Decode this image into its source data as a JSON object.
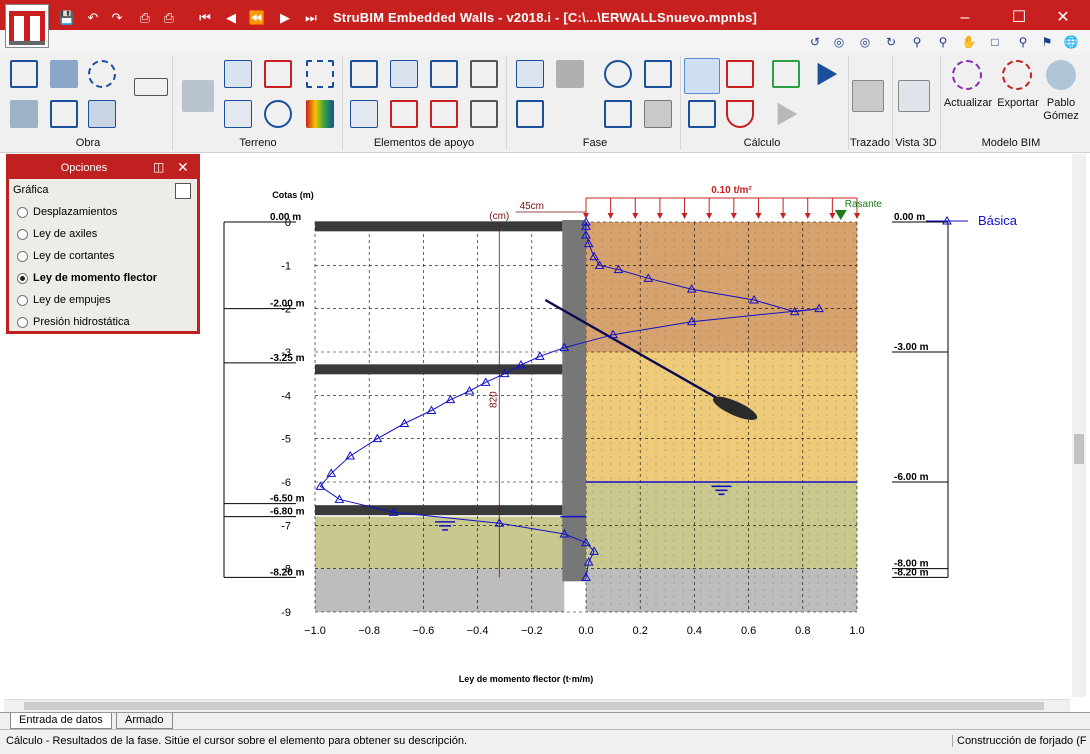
{
  "window": {
    "title": "StruBIM Embedded Walls - v2018.i - [C:\\...\\ERWALLSnuevo.mpnbs]"
  },
  "ribbon": {
    "groups": [
      "Obra",
      "Terreno",
      "Elementos de apoyo",
      "Fase",
      "Cálculo",
      "Trazado",
      "Vista 3D",
      "Modelo BIM"
    ],
    "bim_buttons": [
      "Actualizar",
      "Exportar",
      "Pablo Gómez"
    ]
  },
  "panel": {
    "title": "Opciones",
    "section": "Gráfica",
    "options": [
      {
        "label": "Desplazamientos",
        "selected": false
      },
      {
        "label": "Ley de axiles",
        "selected": false
      },
      {
        "label": "Ley de cortantes",
        "selected": false
      },
      {
        "label": "Ley de momento flector",
        "selected": true
      },
      {
        "label": "Ley de empujes",
        "selected": false
      },
      {
        "label": "Presión hidrostática",
        "selected": false
      }
    ]
  },
  "drawing": {
    "cotas_label": "Cotas (m)",
    "load_label": "0.10 t/m²",
    "rasante_label": "Rasante",
    "width_label": "45cm",
    "cm_label": "(cm)",
    "depth_cm_label": "820",
    "legend_label": "Básica",
    "left_levels": [
      {
        "label": "0.00 m",
        "value": 0
      },
      {
        "label": "-2.00 m",
        "value": -2
      },
      {
        "label": "-3.25 m",
        "value": -3.25
      },
      {
        "label": "-6.50 m",
        "value": -6.5
      },
      {
        "label": "-6.80 m",
        "value": -6.8
      },
      {
        "label": "-8.20 m",
        "value": -8.2
      }
    ],
    "right_levels": [
      {
        "label": "0.00 m",
        "value": 0
      },
      {
        "label": "-3.00 m",
        "value": -3
      },
      {
        "label": "-6.00 m",
        "value": -6
      },
      {
        "label": "-8.00 m",
        "value": -8
      },
      {
        "label": "-8.20 m",
        "value": -8.2
      }
    ],
    "soil_layers": [
      {
        "top": 0,
        "bottom": -3,
        "color": "#d6a26e"
      },
      {
        "top": -3,
        "bottom": -6,
        "color": "#eecb7a"
      },
      {
        "top": -6,
        "bottom": -8,
        "color": "#c9c98f"
      },
      {
        "top": -8,
        "bottom": -9,
        "color": "#bdbdbd"
      }
    ],
    "props_depths": [
      -0.1,
      -3.4,
      -6.65
    ],
    "water_right": -6,
    "water_left": -6.8,
    "wall_bottom": -8.2
  },
  "chart_data": {
    "type": "line",
    "xlabel": "Ley de momento flector (t·m/m)",
    "ylabel": "Cotas (m)",
    "xlim": [
      -1.0,
      1.0
    ],
    "ylim": [
      -9,
      0
    ],
    "xticks": [
      -1.0,
      -0.8,
      -0.6,
      -0.4,
      -0.2,
      0.0,
      0.2,
      0.4,
      0.6,
      0.8,
      1.0
    ],
    "yticks": [
      0,
      -1,
      -2,
      -3,
      -4,
      -5,
      -6,
      -7,
      -8,
      -9
    ],
    "grid": true,
    "legend_position": "top-right",
    "series": [
      {
        "name": "Básica",
        "color": "#1010c8",
        "points": [
          [
            0.0,
            0.0
          ],
          [
            0.0,
            -0.1
          ],
          [
            0.0,
            -0.3
          ],
          [
            0.01,
            -0.5
          ],
          [
            0.03,
            -0.8
          ],
          [
            0.05,
            -1.0
          ],
          [
            0.12,
            -1.1
          ],
          [
            0.23,
            -1.3
          ],
          [
            0.39,
            -1.55
          ],
          [
            0.62,
            -1.8
          ],
          [
            0.77,
            -2.07
          ],
          [
            0.86,
            -2.0
          ],
          [
            0.39,
            -2.3
          ],
          [
            0.1,
            -2.6
          ],
          [
            -0.08,
            -2.9
          ],
          [
            -0.17,
            -3.1
          ],
          [
            -0.24,
            -3.3
          ],
          [
            -0.3,
            -3.5
          ],
          [
            -0.37,
            -3.7
          ],
          [
            -0.43,
            -3.9
          ],
          [
            -0.5,
            -4.1
          ],
          [
            -0.57,
            -4.35
          ],
          [
            -0.67,
            -4.65
          ],
          [
            -0.77,
            -5.0
          ],
          [
            -0.87,
            -5.4
          ],
          [
            -0.94,
            -5.8
          ],
          [
            -0.98,
            -6.1
          ],
          [
            -0.91,
            -6.4
          ],
          [
            -0.71,
            -6.7
          ],
          [
            -0.32,
            -6.95
          ],
          [
            -0.08,
            -7.2
          ],
          [
            0.0,
            -7.4
          ],
          [
            0.03,
            -7.6
          ],
          [
            0.01,
            -7.85
          ],
          [
            0.0,
            -8.2
          ]
        ]
      }
    ]
  }
}
